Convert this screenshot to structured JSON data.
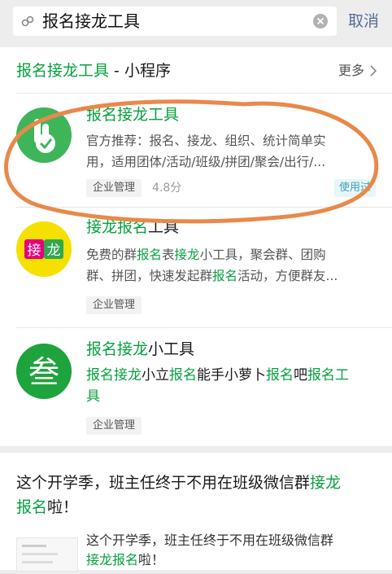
{
  "search": {
    "query": "报名接龙工具",
    "cancel": "取消"
  },
  "section": {
    "title_highlight": "报名接龙工具",
    "title_suffix": " - 小程序",
    "more": "更多"
  },
  "apps": [
    {
      "title": "报名接龙工具",
      "desc_line1": "官方推荐：报名、接龙、组织、统计简单实",
      "desc_line2": "用，适用团体/活动/班级/拼团/聚会/出行/...",
      "tag": "企业管理",
      "rating": "4.8分",
      "badge": "使用过"
    },
    {
      "title_1": "接龙",
      "title_2": "报名",
      "title_3": "工具",
      "desc_1a": "免费的群",
      "desc_1b": "报名",
      "desc_1c": "表",
      "desc_1d": "接龙",
      "desc_1e": "小工具，聚会群、团购",
      "desc_2a": "群、拼团，快速发起群",
      "desc_2b": "报名",
      "desc_2c": "活动，方便群友...",
      "icon_text_1": "接",
      "icon_text_2": "龙",
      "tag": "企业管理"
    },
    {
      "title_1": "报名接龙",
      "title_2": "小工具",
      "desc_1a": "报名接龙",
      "desc_1b": "小立",
      "desc_1c": "报名",
      "desc_1d": "能手小萝卜",
      "desc_1e": "报名",
      "desc_1f": "吧",
      "desc_1g": "报名工",
      "desc_2": "具",
      "icon_text": "叁",
      "tag": "企业管理"
    }
  ],
  "article": {
    "title_a": "这个开学季，班主任终于不用在班级微信群",
    "title_b": "接龙",
    "title_c": "报名",
    "title_d": "啦！",
    "desc_a": "这个开学季，班主任终于不用在班级微信群",
    "desc_b": "接龙",
    "desc_c": "报名",
    "desc_d": "啦！"
  },
  "colors": {
    "accent": "#06a13f",
    "link": "#576b95",
    "highlight_ring": "#e8894a"
  }
}
